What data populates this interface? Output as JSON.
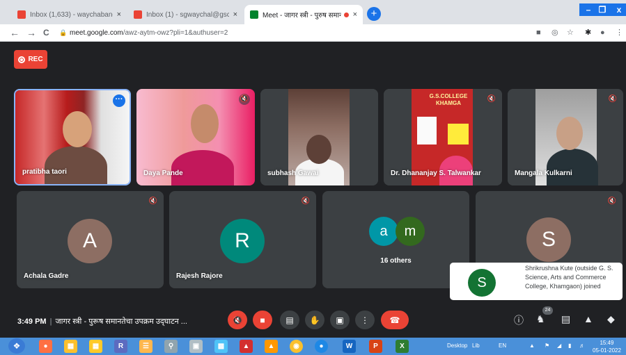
{
  "browser": {
    "tabs": [
      {
        "title": "Inbox (1,633) - waychabangeeta",
        "close": "×",
        "fav_color": "#ea4335"
      },
      {
        "title": "Inbox (1) - sgwaychal@gsck.ac.in",
        "close": "×",
        "fav_color": "#ea4335"
      },
      {
        "title": "Meet - जागर स्त्री - पुरुष समान",
        "close": "×",
        "fav_color": "#00832d"
      }
    ],
    "new_tab": "+",
    "url_host": "meet.google.com",
    "url_path": "/awz-aytm-owz?pli=1&authuser=2",
    "nav": {
      "back": "←",
      "forward": "→",
      "reload": "C"
    },
    "window": {
      "minimize": "–",
      "restore": "❐",
      "close": "x"
    }
  },
  "meeting": {
    "rec_label": "REC",
    "participants_top": [
      {
        "name": "pratibha taori"
      },
      {
        "name": "Daya Pande"
      },
      {
        "name": "subhash Gawai"
      },
      {
        "name": "Dr. Dhananjay S. Talwankar"
      },
      {
        "name": "Mangala Kulkarni"
      }
    ],
    "participants_bottom": [
      {
        "name": "Achala Gadre",
        "initial": "A",
        "color": "#8d6e63"
      },
      {
        "name": "Rajesh Rajore",
        "initial": "R",
        "color": "#00897b"
      },
      {
        "name": "",
        "initial": "S",
        "color": "#8d6e63"
      }
    ],
    "others": {
      "label": "16 others",
      "a": "a",
      "m": "m",
      "a_color": "#0097a7",
      "m_color": "#33691e"
    },
    "toast": {
      "initial": "S",
      "message": "Shrikrushna Kute (outside G. S. Science, Arts and Commerce College, Khamgaon) joined"
    },
    "time": "3:49 PM",
    "title": "जागर स्त्री - पुरूष समानतेचा उपक्रम उद्‌घाटन ...",
    "people_count": "24",
    "board_text": "G.S.COLLEGE KHAMGA"
  },
  "taskbar": {
    "desktop_label": "Desktop",
    "lib_label": "Lib",
    "lang": "EN",
    "time": "15:49",
    "date": "05-01-2022"
  }
}
